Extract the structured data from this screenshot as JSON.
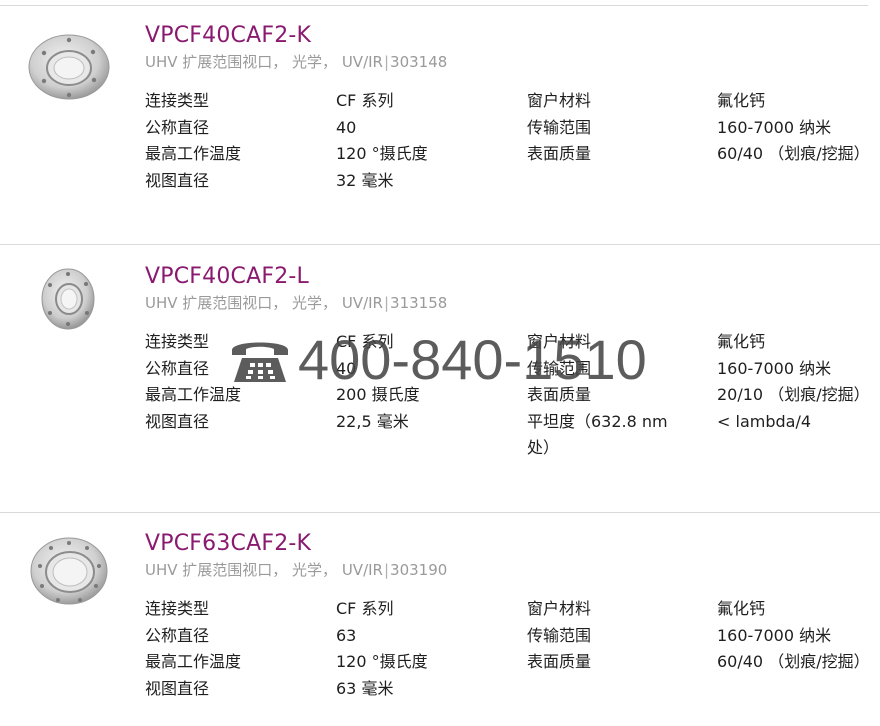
{
  "products": [
    {
      "title": "VPCF40CAF2-K",
      "subtitle": "UHV 扩展范围视口， 光学， UV/IR",
      "part_number": "303148",
      "specs": {
        "col1": [
          "连接类型",
          "公称直径",
          "最高工作温度",
          "视图直径"
        ],
        "col2": [
          "CF 系列",
          "40",
          "120 °摄氏度",
          "32 毫米"
        ],
        "col3": [
          "窗户材料",
          "传输范围",
          "表面质量"
        ],
        "col4": [
          "氟化钙",
          "160-7000 纳米",
          "60/40 （划痕/挖掘）"
        ]
      }
    },
    {
      "title": "VPCF40CAF2-L",
      "subtitle": "UHV 扩展范围视口， 光学， UV/IR",
      "part_number": "313158",
      "specs": {
        "col1": [
          "连接类型",
          "公称直径",
          "最高工作温度",
          "视图直径"
        ],
        "col2": [
          "CF 系列",
          "40",
          "200 摄氏度",
          "22,5 毫米"
        ],
        "col3": [
          "窗户材料",
          "传输范围",
          "表面质量",
          "平坦度（632.8 nm 处）"
        ],
        "col4": [
          "氟化钙",
          "160-7000 纳米",
          "20/10 （划痕/挖掘）",
          "< lambda/4"
        ]
      }
    },
    {
      "title": "VPCF63CAF2-K",
      "subtitle": "UHV 扩展范围视口， 光学， UV/IR",
      "part_number": "303190",
      "specs": {
        "col1": [
          "连接类型",
          "公称直径",
          "最高工作温度",
          "视图直径"
        ],
        "col2": [
          "CF 系列",
          "63",
          "120 °摄氏度",
          "63 毫米"
        ],
        "col3": [
          "窗户材料",
          "传输范围",
          "表面质量"
        ],
        "col4": [
          "氟化钙",
          "160-7000 纳米",
          "60/40 （划痕/挖掘）"
        ]
      }
    }
  ],
  "watermark": {
    "icon": "telephone-icon",
    "text": "400-840-1510"
  },
  "colors": {
    "title": "#8a1a6f",
    "subtitle": "#9a9a9a",
    "divider": "#d9d9d9",
    "text": "#1f1f1f"
  }
}
